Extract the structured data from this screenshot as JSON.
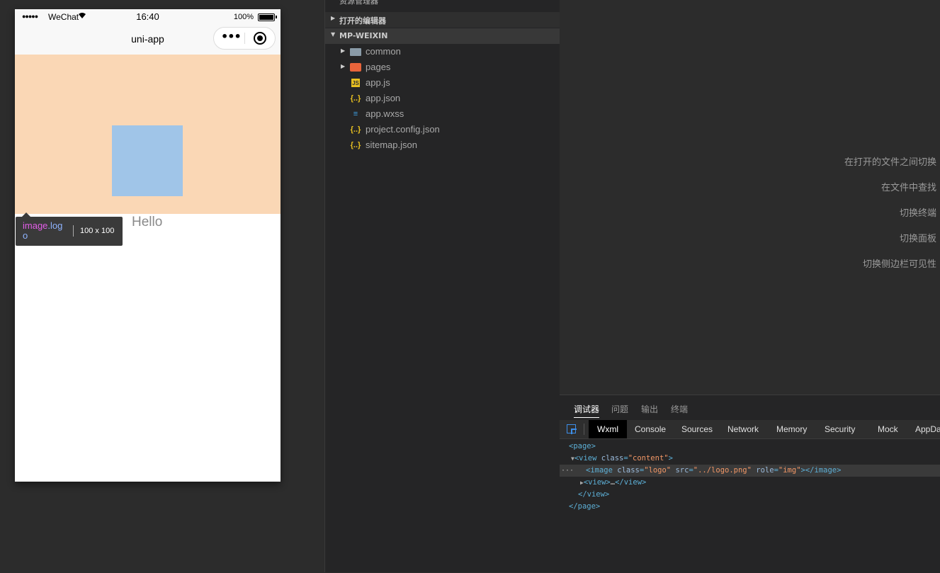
{
  "simulator": {
    "status": {
      "signal": "●●●●●",
      "carrier": "WeChat",
      "time": "16:40",
      "battery": "100%"
    },
    "nav_title": "uni-app",
    "capsule_more": "•••",
    "hello": "Hello",
    "tooltip": {
      "tag": "image",
      "cls": ".logo",
      "size": "100 x 100"
    }
  },
  "explorer": {
    "header": "资源管理器",
    "more": "···",
    "open_editors": "打开的编辑器",
    "project": "MP-WEIXIN",
    "files": [
      {
        "name": "common",
        "icon": "folder-icon"
      },
      {
        "name": "pages",
        "icon": "folder-pages-icon"
      },
      {
        "name": "app.js",
        "icon": "js-file-icon"
      },
      {
        "name": "app.json",
        "icon": "json-file-icon"
      },
      {
        "name": "app.wxss",
        "icon": "wxss-file-icon"
      },
      {
        "name": "project.config.json",
        "icon": "json-file-icon"
      },
      {
        "name": "sitemap.json",
        "icon": "json-file-icon"
      }
    ]
  },
  "editor": {
    "shortcuts": [
      "在打开的文件之间切换",
      "在文件中查找",
      "切换终端",
      "切换面板",
      "切换侧边栏可见性"
    ]
  },
  "panel": {
    "tabs": [
      "调试器",
      "问题",
      "输出",
      "终端"
    ],
    "devtools_tabs": [
      "Wxml",
      "Console",
      "Sources",
      "Network",
      "Memory",
      "Security",
      "Mock",
      "AppData"
    ],
    "wxml": {
      "page_open": "<page>",
      "view_open_tag": "<view",
      "view_attr": "class",
      "view_val": "\"content\"",
      "image_open": "<image",
      "image_attr1": "class",
      "image_val1": "\"logo\"",
      "image_attr2": "src",
      "image_val2": "\"../logo.png\"",
      "image_attr3": "role",
      "image_val3": "\"img\"",
      "image_close": "></image>",
      "collapsed_view_open": "<view>",
      "ellipsis": "…",
      "collapsed_view_close": "</view>",
      "view_close": "</view>",
      "page_close": "</page>"
    }
  },
  "colors": {
    "accent": "#3d8ee8",
    "content_bg": "#fad7b5",
    "logo_bg": "#a0c5e8"
  }
}
